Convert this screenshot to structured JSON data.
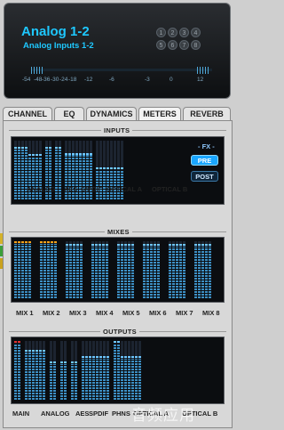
{
  "header": {
    "title": "Analog 1-2",
    "subtitle": "Analog Inputs 1-2",
    "channel_buttons": [
      "1",
      "2",
      "3",
      "4",
      "5",
      "6",
      "7",
      "8"
    ],
    "scale_ticks": [
      "-54",
      "-48",
      "-36",
      "-30",
      "-24",
      "-18",
      "-12",
      "-6",
      "-3",
      "0",
      "12"
    ]
  },
  "tabs": [
    {
      "label": "CHANNEL",
      "active": false
    },
    {
      "label": "EQ",
      "active": false
    },
    {
      "label": "DYNAMICS",
      "active": false
    },
    {
      "label": "METERS",
      "active": true
    },
    {
      "label": "REVERB",
      "active": false
    }
  ],
  "inputs": {
    "title": "INPUTS",
    "groups": [
      {
        "label": "ANALOG",
        "levels": [
          0.85,
          0.85,
          0.85,
          0.85,
          0.72,
          0.72,
          0.72,
          0.72
        ],
        "peak_color": "blue"
      },
      {
        "label": "AES",
        "levels": [
          0.85,
          0.85
        ],
        "peak_color": "blue"
      },
      {
        "label": "S/PDIF",
        "levels": [
          0.85,
          0.85
        ],
        "peak_color": "blue"
      },
      {
        "label": "OPTICAL A",
        "levels": [
          0.75,
          0.75,
          0.75,
          0.75,
          0.75,
          0.75,
          0.75,
          0.75
        ],
        "peak_color": "blue"
      },
      {
        "label": "OPTICAL B",
        "levels": [
          0.5,
          0.5,
          0.5,
          0.5,
          0.5,
          0.5,
          0.5,
          0.5
        ],
        "peak_color": "blue"
      }
    ],
    "fx": {
      "label": "- FX -",
      "pre": "PRE",
      "post": "POST",
      "selected": "PRE"
    }
  },
  "mixes": {
    "title": "MIXES",
    "items": [
      {
        "label": "MIX 1",
        "level": 0.95,
        "peak_color": "amber"
      },
      {
        "label": "MIX 2",
        "level": 0.95,
        "peak_color": "amber"
      },
      {
        "label": "MIX 3",
        "level": 0.9,
        "peak_color": "blue"
      },
      {
        "label": "MIX 4",
        "level": 0.9,
        "peak_color": "blue"
      },
      {
        "label": "MIX 5",
        "level": 0.9,
        "peak_color": "blue"
      },
      {
        "label": "MIX 6",
        "level": 0.9,
        "peak_color": "blue"
      },
      {
        "label": "MIX 7",
        "level": 0.9,
        "peak_color": "blue"
      },
      {
        "label": "MIX 8",
        "level": 0.9,
        "peak_color": "blue"
      }
    ]
  },
  "outputs": {
    "title": "OUTPUTS",
    "groups": [
      {
        "label": "MAIN",
        "levels": [
          0.95,
          0.95
        ],
        "peak_color": "red"
      },
      {
        "label": "ANALOG",
        "levels": [
          0.8,
          0.8,
          0.8,
          0.8,
          0.8,
          0.8
        ],
        "peak_color": "blue"
      },
      {
        "label": "AES",
        "levels": [
          0.6,
          0.6
        ],
        "peak_color": "blue"
      },
      {
        "label": "SPDIF",
        "levels": [
          0.6,
          0.6
        ],
        "peak_color": "blue"
      },
      {
        "label": "PHNS",
        "levels": [
          0.6,
          0.6
        ],
        "peak_color": "blue"
      },
      {
        "label": "OPTICAL A",
        "levels": [
          0.7,
          0.7,
          0.7,
          0.7,
          0.7,
          0.7,
          0.7,
          0.7
        ],
        "peak_color": "blue"
      },
      {
        "label": "OPTICAL B",
        "levels": [
          0.95,
          0.95,
          0.7,
          0.7,
          0.7,
          0.7,
          0.7,
          0.7
        ],
        "peak_color": "blue"
      }
    ]
  },
  "colors": {
    "accent": "#1ec8ff",
    "meter_fill": "#3d8fc4",
    "peak_blue": "#6ec7ff",
    "peak_amber": "#f6a21a",
    "peak_red": "#e03030",
    "fx_selected": "#1aa6ff"
  },
  "watermark": "音频应用"
}
